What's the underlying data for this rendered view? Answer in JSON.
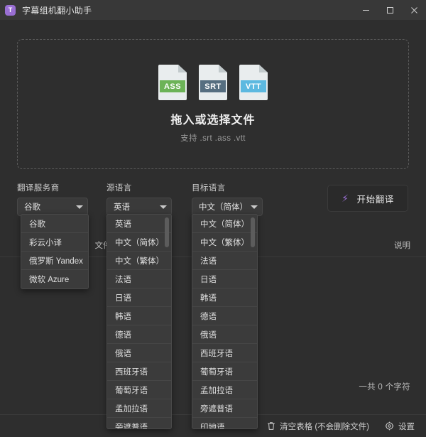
{
  "window": {
    "title": "字幕组机翻小助手",
    "icon_letter": "T",
    "minimize_label": "最小化",
    "maximize_label": "最大化",
    "close_label": "关闭"
  },
  "dropzone": {
    "title": "拖入或选择文件",
    "subtitle": "支持 .srt .ass .vtt",
    "file_types": [
      {
        "ext": "ASS",
        "color": "#6cb357"
      },
      {
        "ext": "SRT",
        "color": "#566e80"
      },
      {
        "ext": "VTT",
        "color": "#5db9e0"
      }
    ]
  },
  "controls": {
    "provider": {
      "label": "翻译服务商",
      "value": "谷歌",
      "options": [
        "谷歌",
        "彩云小译",
        "俄罗斯 Yandex",
        "微软 Azure"
      ]
    },
    "source_language": {
      "label": "源语言",
      "value": "英语",
      "options": [
        "英语",
        "中文（简体）",
        "中文（繁体）",
        "法语",
        "日语",
        "韩语",
        "德语",
        "俄语",
        "西班牙语",
        "葡萄牙语",
        "孟加拉语",
        "旁遮普语"
      ]
    },
    "target_language": {
      "label": "目标语言",
      "value": "中文（简体）",
      "options": [
        "中文（简体）",
        "中文（繁体）",
        "法语",
        "日语",
        "韩语",
        "德语",
        "俄语",
        "西班牙语",
        "葡萄牙语",
        "孟加拉语",
        "旁遮普语",
        "印地语"
      ]
    },
    "start_button": {
      "label": "开始翻译",
      "icon": "lightning-bolt-icon",
      "accent": "#9a6fd4"
    }
  },
  "table": {
    "columns": [
      "文件名",
      "说明"
    ],
    "rows": [],
    "char_count": "一共 0 个字符"
  },
  "bottom_bar": {
    "clear_table": {
      "label": "清空表格 (不会删除文件)",
      "icon": "trash-icon"
    },
    "settings": {
      "label": "设置",
      "icon": "gear-icon"
    }
  }
}
